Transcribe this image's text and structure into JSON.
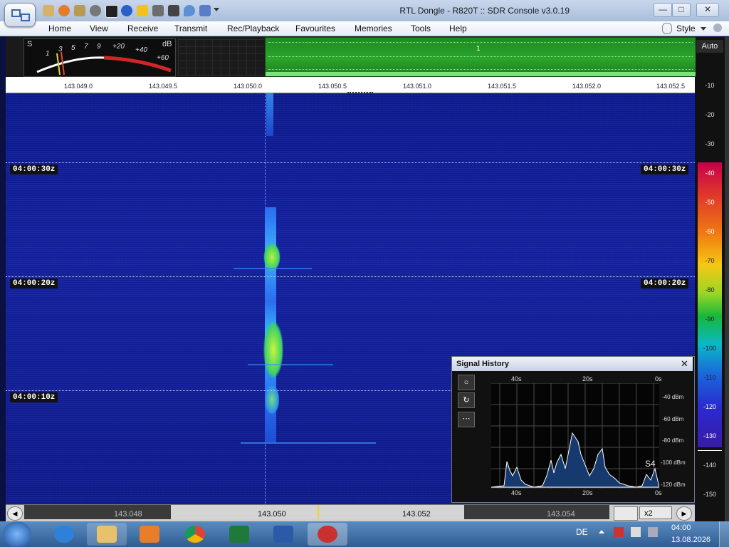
{
  "window": {
    "title": "RTL Dongle - R820T :: SDR Console v3.0.19",
    "controls": {
      "minimize": "—",
      "maximize": "□",
      "close": "✕"
    }
  },
  "menu": {
    "items": [
      "Home",
      "View",
      "Receive",
      "Transmit",
      "Rec/Playback",
      "Favourites",
      "Memories",
      "Tools",
      "Help"
    ],
    "style_label": "Style"
  },
  "meter": {
    "s_label": "S",
    "db_label": "dB",
    "scale": [
      "1",
      "3",
      "5",
      "7",
      "9",
      "+20",
      "+40",
      "+60"
    ]
  },
  "spectrum": {
    "auto_label": "Auto",
    "marker_label": "1"
  },
  "freq_scale": {
    "ticks": [
      "143.049.0",
      "143.049.5",
      "143.050.0",
      "143.050.5",
      "143.051.0",
      "143.051.5",
      "143.052.0",
      "143.052.5"
    ]
  },
  "waterfall": {
    "time_labels": [
      "04:00:30z",
      "04:00:20z",
      "04:00:10z"
    ]
  },
  "db_scale": {
    "values": [
      "-10",
      "-20",
      "-30",
      "-40",
      "-50",
      "-60",
      "-70",
      "-80",
      "-90",
      "-100",
      "-110",
      "-120",
      "-130",
      "-140",
      "-150"
    ]
  },
  "signal_history": {
    "title": "Signal History",
    "close": "✕",
    "top_labels": [
      "40s",
      "20s",
      "0s"
    ],
    "bottom_labels": [
      "40s",
      "20s",
      "0s"
    ],
    "y_labels": [
      "-40 dBm",
      "-60 dBm",
      "-80 dBm",
      "-100 dBm",
      "-120 dBm"
    ],
    "s_reading": "S4",
    "tool_buttons": [
      "○",
      "↻",
      "⋯"
    ]
  },
  "bottom_bar": {
    "freqs": [
      "143.048",
      "143.050",
      "143.052",
      "143.054"
    ],
    "zoom": "x2"
  },
  "taskbar": {
    "lang": "DE",
    "time": "04:00",
    "date": "13.08.2026"
  },
  "colors": {
    "waterfall_bg": "#14219c",
    "signal_green": "#9be830",
    "title_text": "#1b1b1b"
  }
}
